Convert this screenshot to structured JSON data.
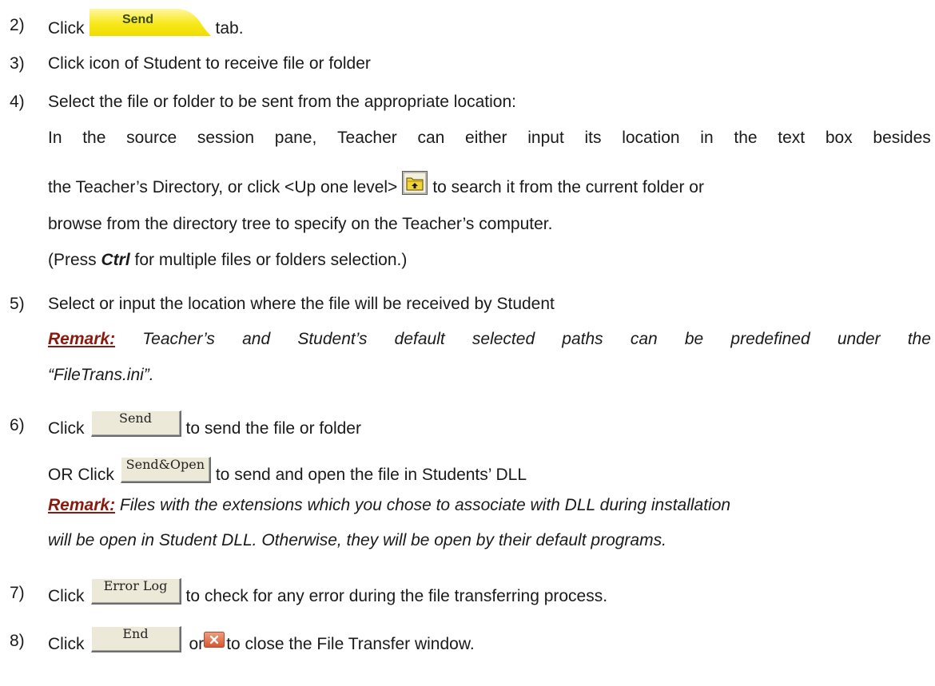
{
  "steps": {
    "s2": {
      "num": "2)",
      "pre": "Click",
      "tab_label": "Send",
      "post": "tab."
    },
    "s3": {
      "num": "3)",
      "text": "Click icon of Student to receive file or folder"
    },
    "s4": {
      "num": "4)",
      "line1": "Select the file or folder to be sent from the appropriate location:",
      "line2_words": [
        "In",
        "the",
        "source",
        "session",
        "pane,",
        "Teacher",
        "can",
        "either",
        "input",
        "its",
        "location",
        "in",
        "the",
        "text",
        "box",
        "besides"
      ],
      "line3_pre": "the Teacher’s Directory, or click <Up one level>",
      "line3_post": "to search it from the current folder or",
      "line4": "browse from the directory tree to specify on the Teacher’s computer.",
      "line5_pre": "(Press ",
      "line5_key": "Ctrl",
      "line5_post": " for multiple files or folders selection.)"
    },
    "s5": {
      "num": "5)",
      "line1": "Select or input the location where the file will be received by Student",
      "remark_label": "Remark",
      "remark_colon": ":",
      "remark_words": [
        "Teacher’s",
        "and",
        "Student’s",
        "default",
        "selected",
        "paths",
        "can",
        "be",
        "predefined",
        "under",
        "the"
      ],
      "remark_line2": "“FileTrans.ini”."
    },
    "s6": {
      "num": "6)",
      "pre": "Click",
      "send_button": "Send",
      "post": "to send the file or folder",
      "or_pre": "OR Click",
      "sendopen_button": "Send&Open",
      "or_post": "to send and open the file in Students’ DLL",
      "remark_label": "Remark",
      "remark_colon": ":",
      "remark_line1": " Files with the extensions which you chose to associate with DLL during installation",
      "remark_line2": "will be open in Student DLL. Otherwise, they will be open by their default programs."
    },
    "s7": {
      "num": "7)",
      "pre": "Click",
      "button": "Error Log",
      "post": "to check for any error during the file transferring process."
    },
    "s8": {
      "num": "8)",
      "pre": "Click",
      "button": "End",
      "or": "or",
      "post": "to close the File Transfer window."
    }
  },
  "icons": {
    "up_one_level": "folder-up-icon",
    "close": "close-window-icon"
  },
  "colors": {
    "send_tab": "#f7e81a",
    "remark": "#8b1a0e",
    "button_face": "#ece9d8"
  }
}
